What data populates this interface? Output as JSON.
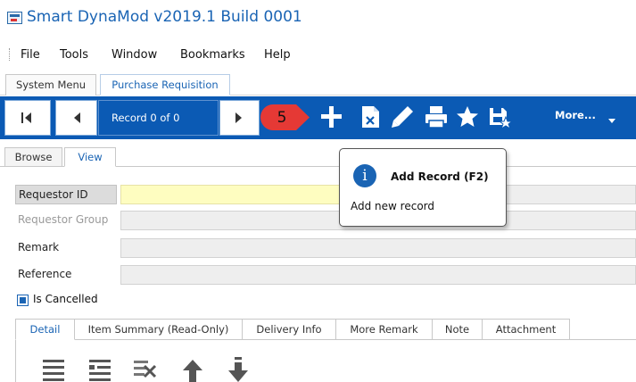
{
  "window": {
    "title": "Smart DynaMod v2019.1 Build 0001"
  },
  "menu": {
    "items": [
      {
        "label": "File"
      },
      {
        "label": "Tools"
      },
      {
        "label": "Window"
      },
      {
        "label": "Bookmarks"
      },
      {
        "label": "Help"
      }
    ]
  },
  "module_tabs": [
    {
      "label": "System Menu",
      "active": false
    },
    {
      "label": "Purchase Requisition",
      "active": true
    }
  ],
  "toolbar": {
    "record_status": "Record 0 of 0",
    "more_label": "More...",
    "icons": [
      "first-record-icon",
      "previous-record-icon",
      "next-record-icon",
      "add-icon",
      "delete-icon",
      "edit-icon",
      "print-icon",
      "bookmark-star-icon",
      "save-icon",
      "chevron-down-icon"
    ],
    "accent_color": "#0b5ab4"
  },
  "step_badge": {
    "text": "5",
    "color": "#e53935"
  },
  "view_tabs": [
    {
      "label": "Browse",
      "active": false
    },
    {
      "label": "View",
      "active": true
    }
  ],
  "form": {
    "fields": [
      {
        "label": "Requestor ID",
        "value": ""
      },
      {
        "label": "Requestor Group",
        "value": ""
      },
      {
        "label": "Remark",
        "value": ""
      },
      {
        "label": "Reference",
        "value": ""
      }
    ],
    "is_cancelled": {
      "label": "Is Cancelled",
      "checked": true
    }
  },
  "detail_tabs": [
    {
      "label": "Detail",
      "active": true
    },
    {
      "label": "Item Summary (Read-Only)",
      "active": false
    },
    {
      "label": "Delivery Info",
      "active": false
    },
    {
      "label": "More Remark",
      "active": false
    },
    {
      "label": "Note",
      "active": false
    },
    {
      "label": "Attachment",
      "active": false
    }
  ],
  "detail_toolbar": {
    "icons": [
      "insert-row-icon",
      "add-row-icon",
      "clear-rows-icon",
      "move-up-icon",
      "move-down-icon"
    ]
  },
  "tooltip": {
    "icon_text": "i",
    "title": "Add Record (F2)",
    "description": "Add new record"
  }
}
